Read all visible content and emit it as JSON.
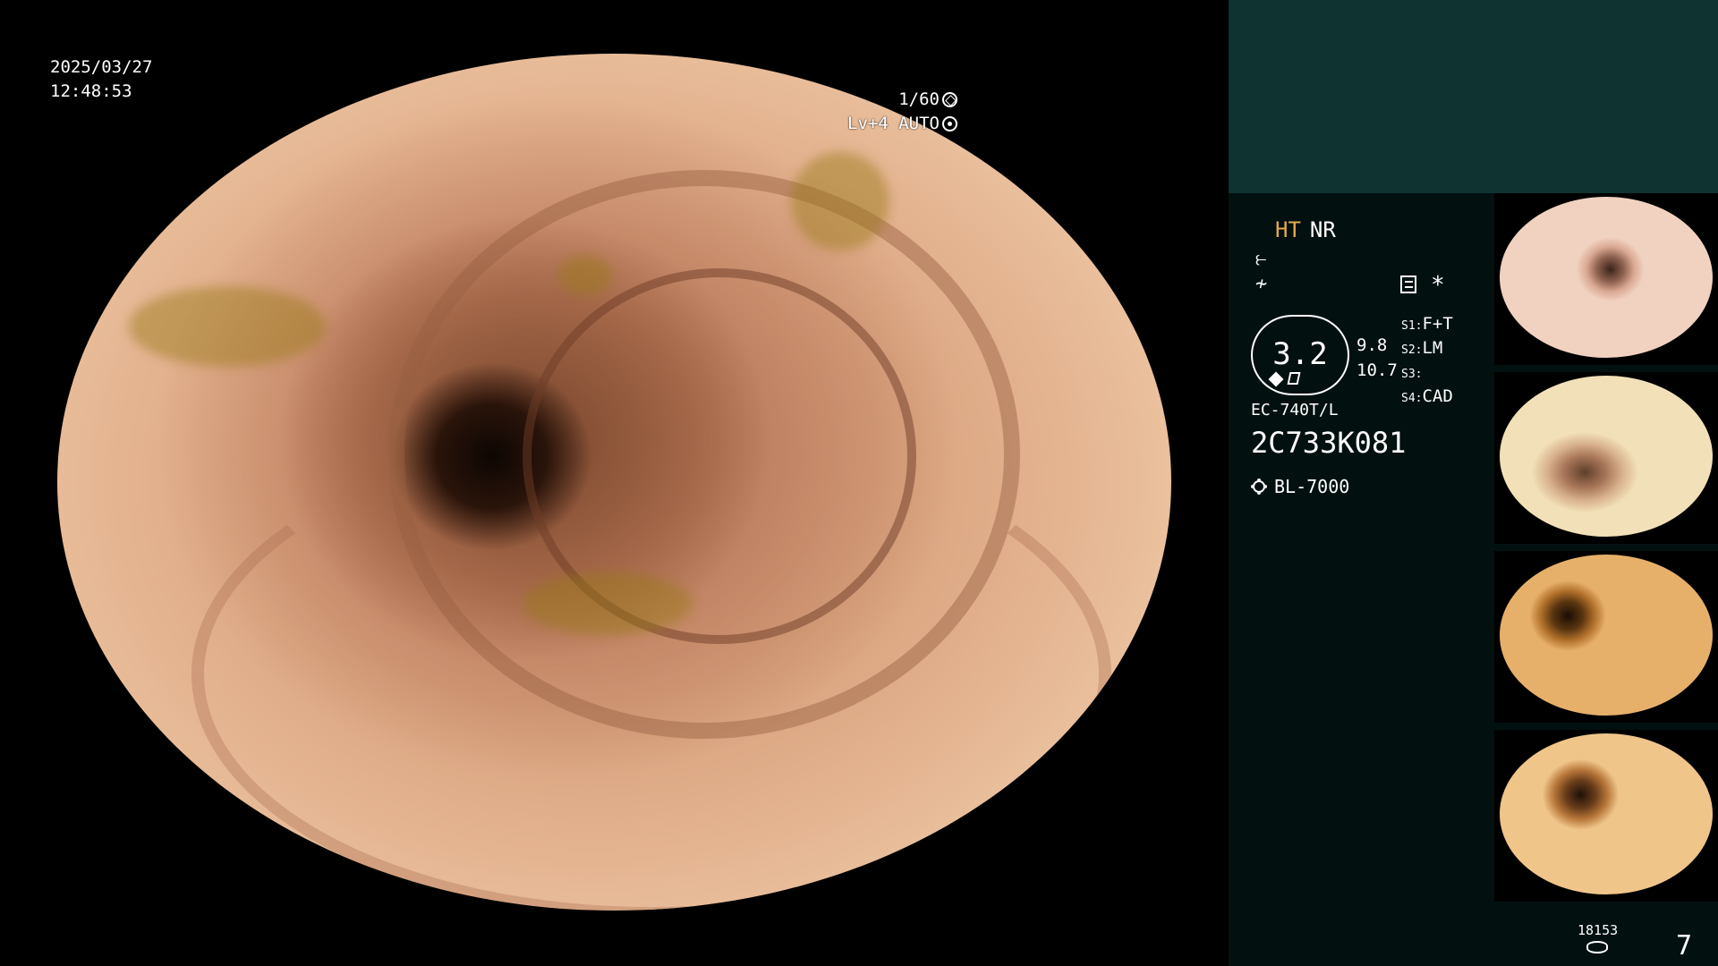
{
  "overlay": {
    "date": "2025/03/27",
    "time": "12:48:53",
    "shutter": "1/60",
    "level_auto": "Lv+4 AUTO"
  },
  "panel": {
    "mode_primary": "HT",
    "mode_secondary": "NR",
    "asterisk": "*",
    "zoom_value": "3.2",
    "range_values": [
      "9.8",
      "10.7"
    ],
    "switches": [
      {
        "key": "S1:",
        "value": "F+T"
      },
      {
        "key": "S2:",
        "value": "LM"
      },
      {
        "key": "S3:",
        "value": ""
      },
      {
        "key": "S4:",
        "value": "CAD"
      }
    ],
    "scope_model": "EC-740T/L",
    "scope_serial": "2C733K081",
    "light_source": "BL-7000",
    "storage_count": "18153",
    "image_number": "7"
  },
  "colors": {
    "panel_bg": "#021010",
    "panel_header": "#0f3331",
    "mode_accent": "#e7a94a"
  },
  "icons": [
    "aperture-icon",
    "gear-icon",
    "structure-enhance-icon",
    "color-enhance-icon",
    "settings-icon",
    "light-source-icon",
    "storage-disk-icon"
  ]
}
